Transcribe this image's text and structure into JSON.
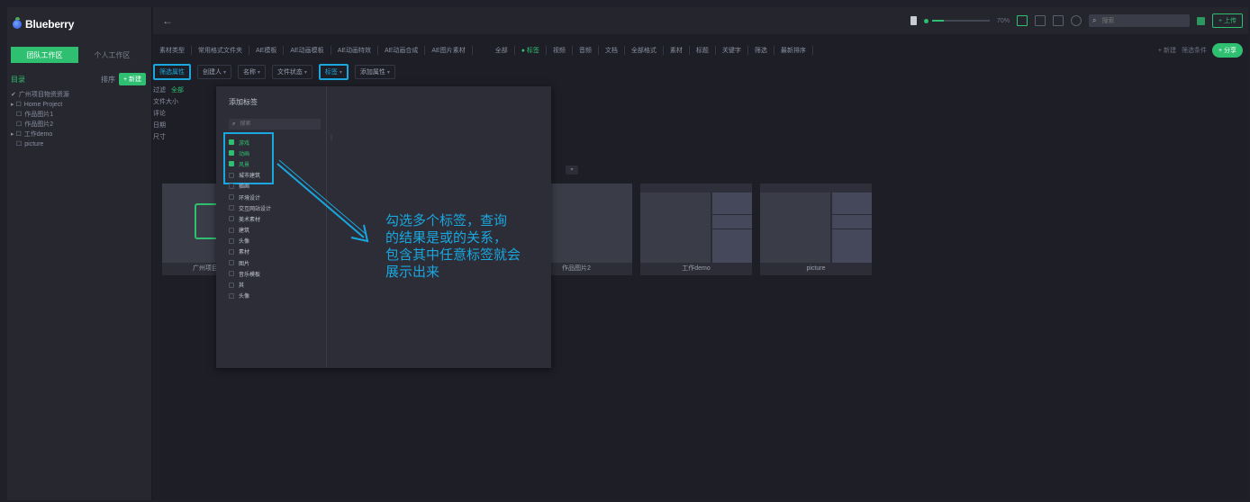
{
  "app": {
    "name": "Blueberry"
  },
  "sidebar": {
    "tabs": [
      "团队工作区",
      "个人工作区"
    ],
    "folder_label": "目录",
    "sort_label": "排序",
    "new_button": "+ 新建",
    "tree": [
      {
        "label": "广州项目物资资源",
        "prefix": "✔"
      },
      {
        "label": "Home Project",
        "prefix": "▸ ☐"
      },
      {
        "label": "作品图片1",
        "prefix": "☐"
      },
      {
        "label": "作品图片2",
        "prefix": "☐"
      },
      {
        "label": "工作demo",
        "prefix": "▸ ☐"
      },
      {
        "label": "picture",
        "prefix": "☐"
      }
    ]
  },
  "topbar": {
    "back": "←",
    "zoom": "70%",
    "search_placeholder": "搜索",
    "upload": "+ 上传"
  },
  "filters": {
    "chips": [
      "素材类型",
      "常用格式文件夹",
      "AE模板",
      "AE动画模板",
      "AE动画特效",
      "AE动画合成",
      "AE图片素材",
      "全部",
      "● 标签",
      "视频",
      "音频",
      "文档",
      "全部格式",
      "素材",
      "标题",
      "关键字",
      "筛选",
      "最新排序"
    ],
    "right_text": "+ 新建",
    "right_text2": "筛选条件",
    "share": "+ 分享"
  },
  "attrs": [
    {
      "label": "筛选属性",
      "highlight": true
    },
    {
      "label": "创建人",
      "highlight": false
    },
    {
      "label": "名称",
      "highlight": false
    },
    {
      "label": "文件状态",
      "highlight": false
    },
    {
      "label": "标签",
      "highlight": true
    },
    {
      "label": "添加属性",
      "highlight": false
    }
  ],
  "filter_panel": {
    "rows": [
      {
        "k": "过滤",
        "v": "全部"
      },
      {
        "k": "文件大小",
        "v": ""
      },
      {
        "k": "评论",
        "v": ""
      },
      {
        "k": "日期",
        "v": ""
      },
      {
        "k": "尺寸",
        "v": ""
      }
    ]
  },
  "tag_dropdown": {
    "title": "添加标签",
    "search_placeholder": "搜索",
    "items": [
      {
        "label": "游戏",
        "checked": true
      },
      {
        "label": "动画",
        "checked": true
      },
      {
        "label": "风景",
        "checked": true
      },
      {
        "label": "城市建筑",
        "checked": false
      },
      {
        "label": "插画",
        "checked": false
      },
      {
        "label": "环境设计",
        "checked": false
      },
      {
        "label": "交互网站设计",
        "checked": false
      },
      {
        "label": "美术素材",
        "checked": false
      },
      {
        "label": "建筑",
        "checked": false
      },
      {
        "label": "头像",
        "checked": false
      },
      {
        "label": "素材",
        "checked": false
      },
      {
        "label": "图片",
        "checked": false
      },
      {
        "label": "音乐模板",
        "checked": false
      },
      {
        "label": "其",
        "checked": false
      },
      {
        "label": "头像",
        "checked": false
      }
    ]
  },
  "thumbs": [
    {
      "caption": "广州项目物资资源"
    },
    {
      "caption": "作品图片2"
    },
    {
      "caption": "工作demo"
    },
    {
      "caption": "picture"
    }
  ],
  "annotation": {
    "lines": [
      "勾选多个标签，查询",
      "的结果是或的关系，",
      "包含其中任意标签就会",
      "展示出来"
    ]
  }
}
